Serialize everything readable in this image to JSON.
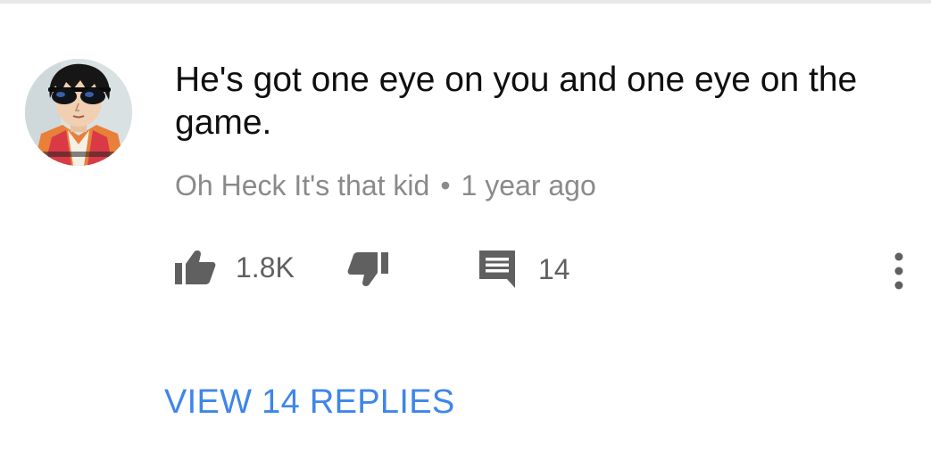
{
  "comment": {
    "text": "He's got one eye on you and one eye on the game.",
    "author": "Oh Heck It's that kid",
    "separator": "•",
    "timestamp": "1 year ago",
    "avatar_icon": "anime-avatar-with-sunglasses"
  },
  "actions": {
    "like_icon": "thumbs-up-icon",
    "like_count": "1.8K",
    "dislike_icon": "thumbs-down-icon",
    "reply_icon": "comment-icon",
    "reply_count": "14",
    "more_icon": "vertical-ellipsis-icon"
  },
  "view_replies_label": "VIEW 14 REPLIES",
  "colors": {
    "text": "#0f0f0f",
    "meta": "#8a8a8a",
    "icon": "#606060",
    "link": "#3e86e8"
  }
}
